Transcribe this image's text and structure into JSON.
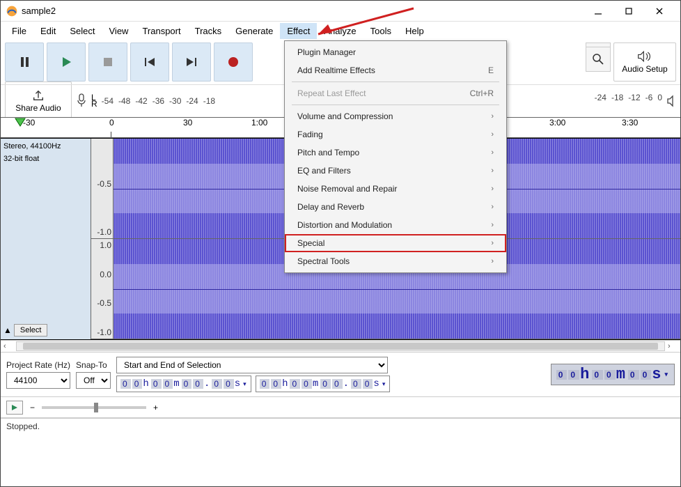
{
  "window": {
    "title": "sample2"
  },
  "menubar": [
    "File",
    "Edit",
    "Select",
    "View",
    "Transport",
    "Tracks",
    "Generate",
    "Effect",
    "Analyze",
    "Tools",
    "Help"
  ],
  "menubar_open_index": 7,
  "effect_menu": {
    "items": [
      {
        "label": "Plugin Manager",
        "type": "item"
      },
      {
        "label": "Add Realtime Effects",
        "type": "item",
        "shortcut": "E"
      },
      {
        "type": "sep"
      },
      {
        "label": "Repeat Last Effect",
        "type": "item",
        "shortcut": "Ctrl+R",
        "disabled": true
      },
      {
        "type": "sep"
      },
      {
        "label": "Volume and Compression",
        "type": "submenu"
      },
      {
        "label": "Fading",
        "type": "submenu"
      },
      {
        "label": "Pitch and Tempo",
        "type": "submenu"
      },
      {
        "label": "EQ and Filters",
        "type": "submenu"
      },
      {
        "label": "Noise Removal and Repair",
        "type": "submenu"
      },
      {
        "label": "Delay and Reverb",
        "type": "submenu"
      },
      {
        "label": "Distortion and Modulation",
        "type": "submenu"
      },
      {
        "label": "Special",
        "type": "submenu",
        "highlight": true
      },
      {
        "label": "Spectral Tools",
        "type": "submenu"
      }
    ]
  },
  "share": {
    "label": "Share Audio"
  },
  "audio_setup": {
    "label": "Audio Setup"
  },
  "db_scale_l": [
    "-54",
    "-48",
    "-42",
    "-36",
    "-30",
    "-24",
    "-18"
  ],
  "db_scale_r": [
    "-24",
    "-18",
    "-12",
    "-6",
    "0"
  ],
  "mic_channels": {
    "l": "L",
    "r": "R"
  },
  "timeline": {
    "start": "-30",
    "marks": [
      "0",
      "30",
      "1:00",
      "3:00",
      "3:30"
    ]
  },
  "track": {
    "line1": "Stereo, 44100Hz",
    "line2": "32-bit float",
    "select_label": "Select"
  },
  "amp_labels": [
    "-0.5",
    "-1.0",
    "1.0",
    "0.0",
    "-0.5",
    "-1.0"
  ],
  "bottom": {
    "rate_label": "Project Rate (Hz)",
    "rate_value": "44100",
    "snap_label": "Snap-To",
    "snap_value": "Off",
    "selection_label": "Start and End of Selection",
    "time_small1": "00h00m00.00s",
    "time_small2": "00h00m00.00s",
    "time_big": "00h00m00s"
  },
  "slider": {
    "minus": "−",
    "plus": "+"
  },
  "status": "Stopped."
}
